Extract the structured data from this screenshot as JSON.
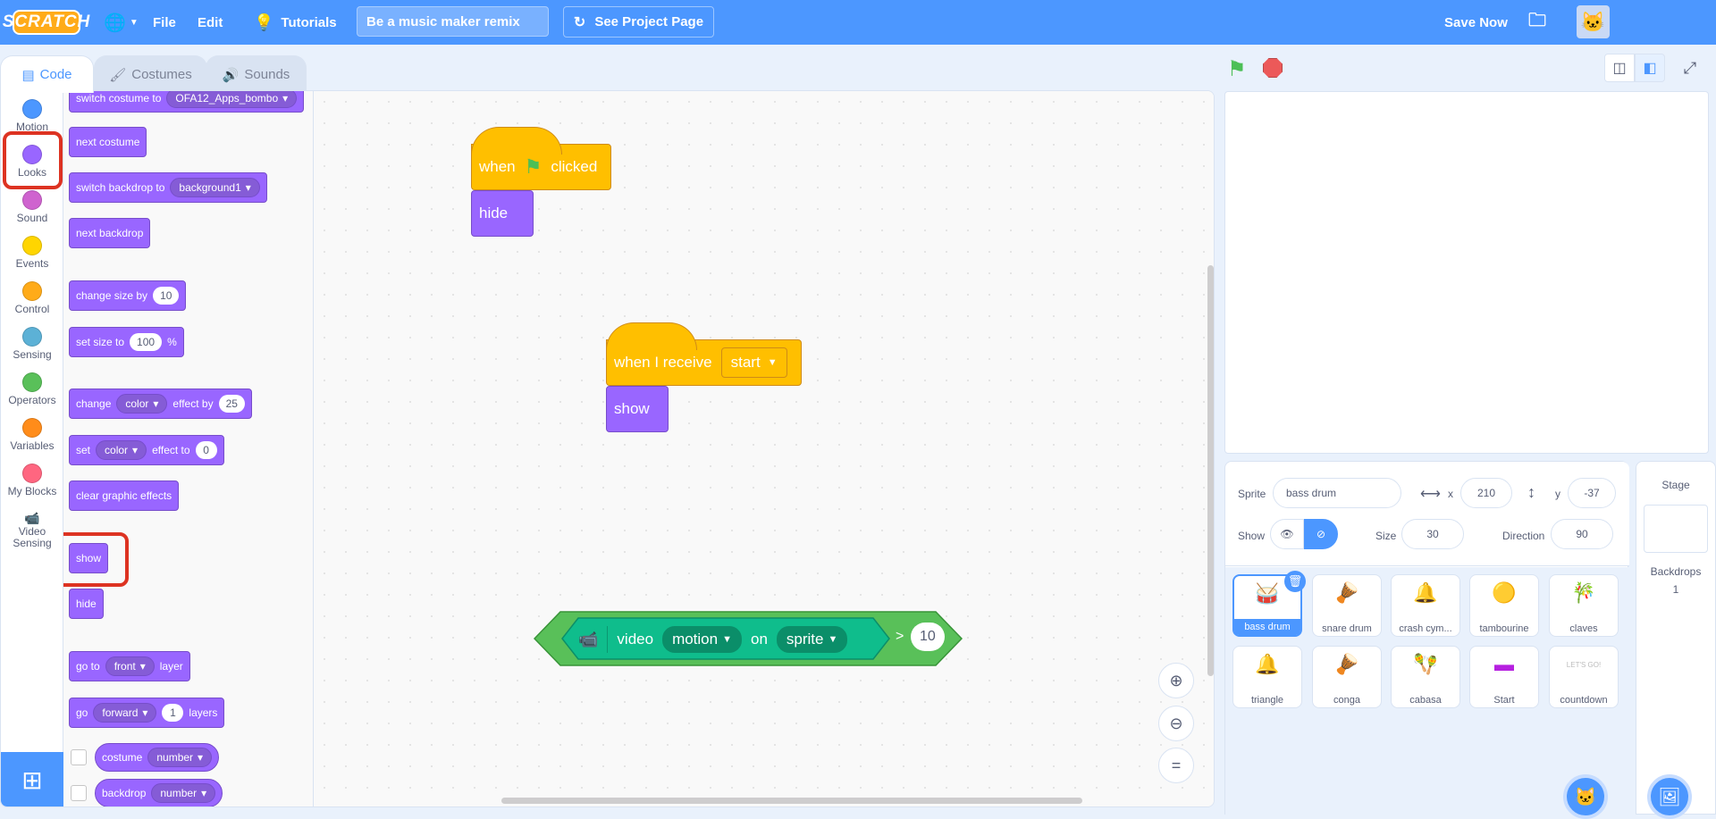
{
  "menubar": {
    "logo": "SCRATCH",
    "file": "File",
    "edit": "Edit",
    "tutorials": "Tutorials",
    "project_title": "Be a music maker remix",
    "see_project_page": "See Project Page",
    "save_now": "Save Now"
  },
  "tabs": {
    "code": "Code",
    "costumes": "Costumes",
    "sounds": "Sounds"
  },
  "categories": [
    {
      "label": "Motion",
      "color": "#4c97ff"
    },
    {
      "label": "Looks",
      "color": "#9966ff"
    },
    {
      "label": "Sound",
      "color": "#cf63cf"
    },
    {
      "label": "Events",
      "color": "#ffd500"
    },
    {
      "label": "Control",
      "color": "#ffab19"
    },
    {
      "label": "Sensing",
      "color": "#5cb1d6"
    },
    {
      "label": "Operators",
      "color": "#59c059"
    },
    {
      "label": "Variables",
      "color": "#ff8c1a"
    },
    {
      "label": "My Blocks",
      "color": "#ff6680"
    },
    {
      "label": "Video Sensing",
      "color": "#0fbd8c"
    }
  ],
  "palette": {
    "switch_costume": {
      "label": "switch costume to",
      "value": "OFA12_Apps_bombo"
    },
    "next_costume": "next costume",
    "switch_backdrop": {
      "label": "switch backdrop to",
      "value": "background1"
    },
    "next_backdrop": "next backdrop",
    "change_size": {
      "label": "change size by",
      "value": "10"
    },
    "set_size": {
      "label": "set size to",
      "value": "100",
      "suffix": "%"
    },
    "change_effect": {
      "label": "change",
      "effect": "color",
      "mid": "effect by",
      "value": "25"
    },
    "set_effect": {
      "label": "set",
      "effect": "color",
      "mid": "effect to",
      "value": "0"
    },
    "clear_effects": "clear graphic effects",
    "show": "show",
    "hide": "hide",
    "go_to_layer": {
      "label": "go to",
      "value": "front",
      "suffix": "layer"
    },
    "go_layers": {
      "label": "go",
      "dir": "forward",
      "value": "1",
      "suffix": "layers"
    },
    "costume_rep": {
      "label": "costume",
      "value": "number"
    },
    "backdrop_rep": {
      "label": "backdrop",
      "value": "number"
    }
  },
  "script": {
    "hat1": {
      "when": "when",
      "clicked": "clicked"
    },
    "hide_block": "hide",
    "hat2": {
      "label": "when I receive",
      "message": "start"
    },
    "show_block": "show",
    "video": {
      "label": "video",
      "attr": "motion",
      "on": "on",
      "target": "sprite",
      "op": ">",
      "value": "10"
    }
  },
  "sprite_info": {
    "sprite_label": "Sprite",
    "sprite_name": "bass drum",
    "x_label": "x",
    "x": "210",
    "y_label": "y",
    "y": "-37",
    "show_label": "Show",
    "size_label": "Size",
    "size": "30",
    "direction_label": "Direction",
    "direction": "90"
  },
  "sprites": [
    {
      "name": "bass drum",
      "icon": "🥁"
    },
    {
      "name": "snare drum",
      "icon": "🪘"
    },
    {
      "name": "crash cym...",
      "icon": "🔔"
    },
    {
      "name": "tambourine",
      "icon": "🟡"
    },
    {
      "name": "claves",
      "icon": "🎋"
    },
    {
      "name": "triangle",
      "icon": "🔔"
    },
    {
      "name": "conga",
      "icon": "🪘"
    },
    {
      "name": "cabasa",
      "icon": "🪇"
    },
    {
      "name": "Start",
      "icon": "▬"
    },
    {
      "name": "countdown",
      "icon": "LET'S GO!"
    }
  ],
  "stage_pane": {
    "title": "Stage",
    "backdrops_label": "Backdrops",
    "backdrops_count": "1"
  }
}
